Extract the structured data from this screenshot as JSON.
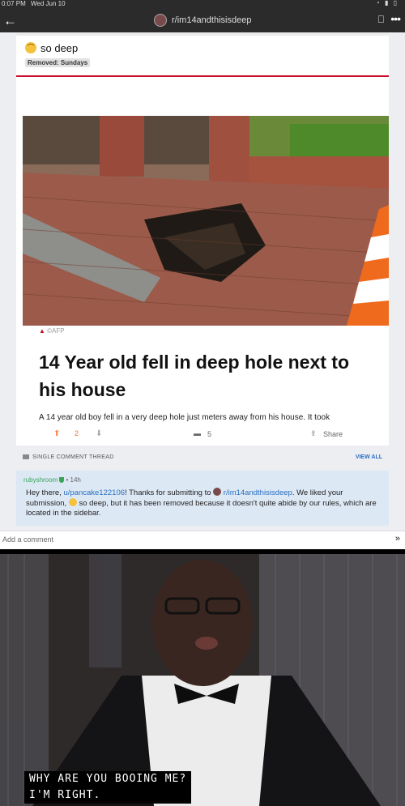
{
  "status": {
    "time": "0:07 PM",
    "date": "Wed Jun 10"
  },
  "header": {
    "subreddit": "r/im14andthisisdeep"
  },
  "post": {
    "title": "so deep",
    "flair": "Removed: Sundays",
    "image": {
      "credit": "AFP",
      "headline": "14 Year old fell in deep hole next to his house",
      "teaser": "A 14 year old boy fell in a very deep hole just meters away from his house. It took"
    },
    "score": "2",
    "comments": "5",
    "share_label": "Share"
  },
  "thread": {
    "label": "SINGLE COMMENT THREAD",
    "view_all": "VIEW ALL"
  },
  "mod_comment": {
    "author": "rubyshroom",
    "age": "14h",
    "text_1": "Hey there, ",
    "user_link": "u/pancake122106",
    "text_2": "! Thanks for submitting to ",
    "sub_link": "r/im14andthisisdeep",
    "text_3": ".  We liked your submission, ",
    "text_4": " so deep, but it has been removed because it doesn't quite abide by our rules, which are located in the sidebar."
  },
  "comment_box": {
    "placeholder": "Add a comment"
  },
  "meme": {
    "line1": "WHY ARE YOU BOOING ME?",
    "line2": "I'M RIGHT."
  }
}
